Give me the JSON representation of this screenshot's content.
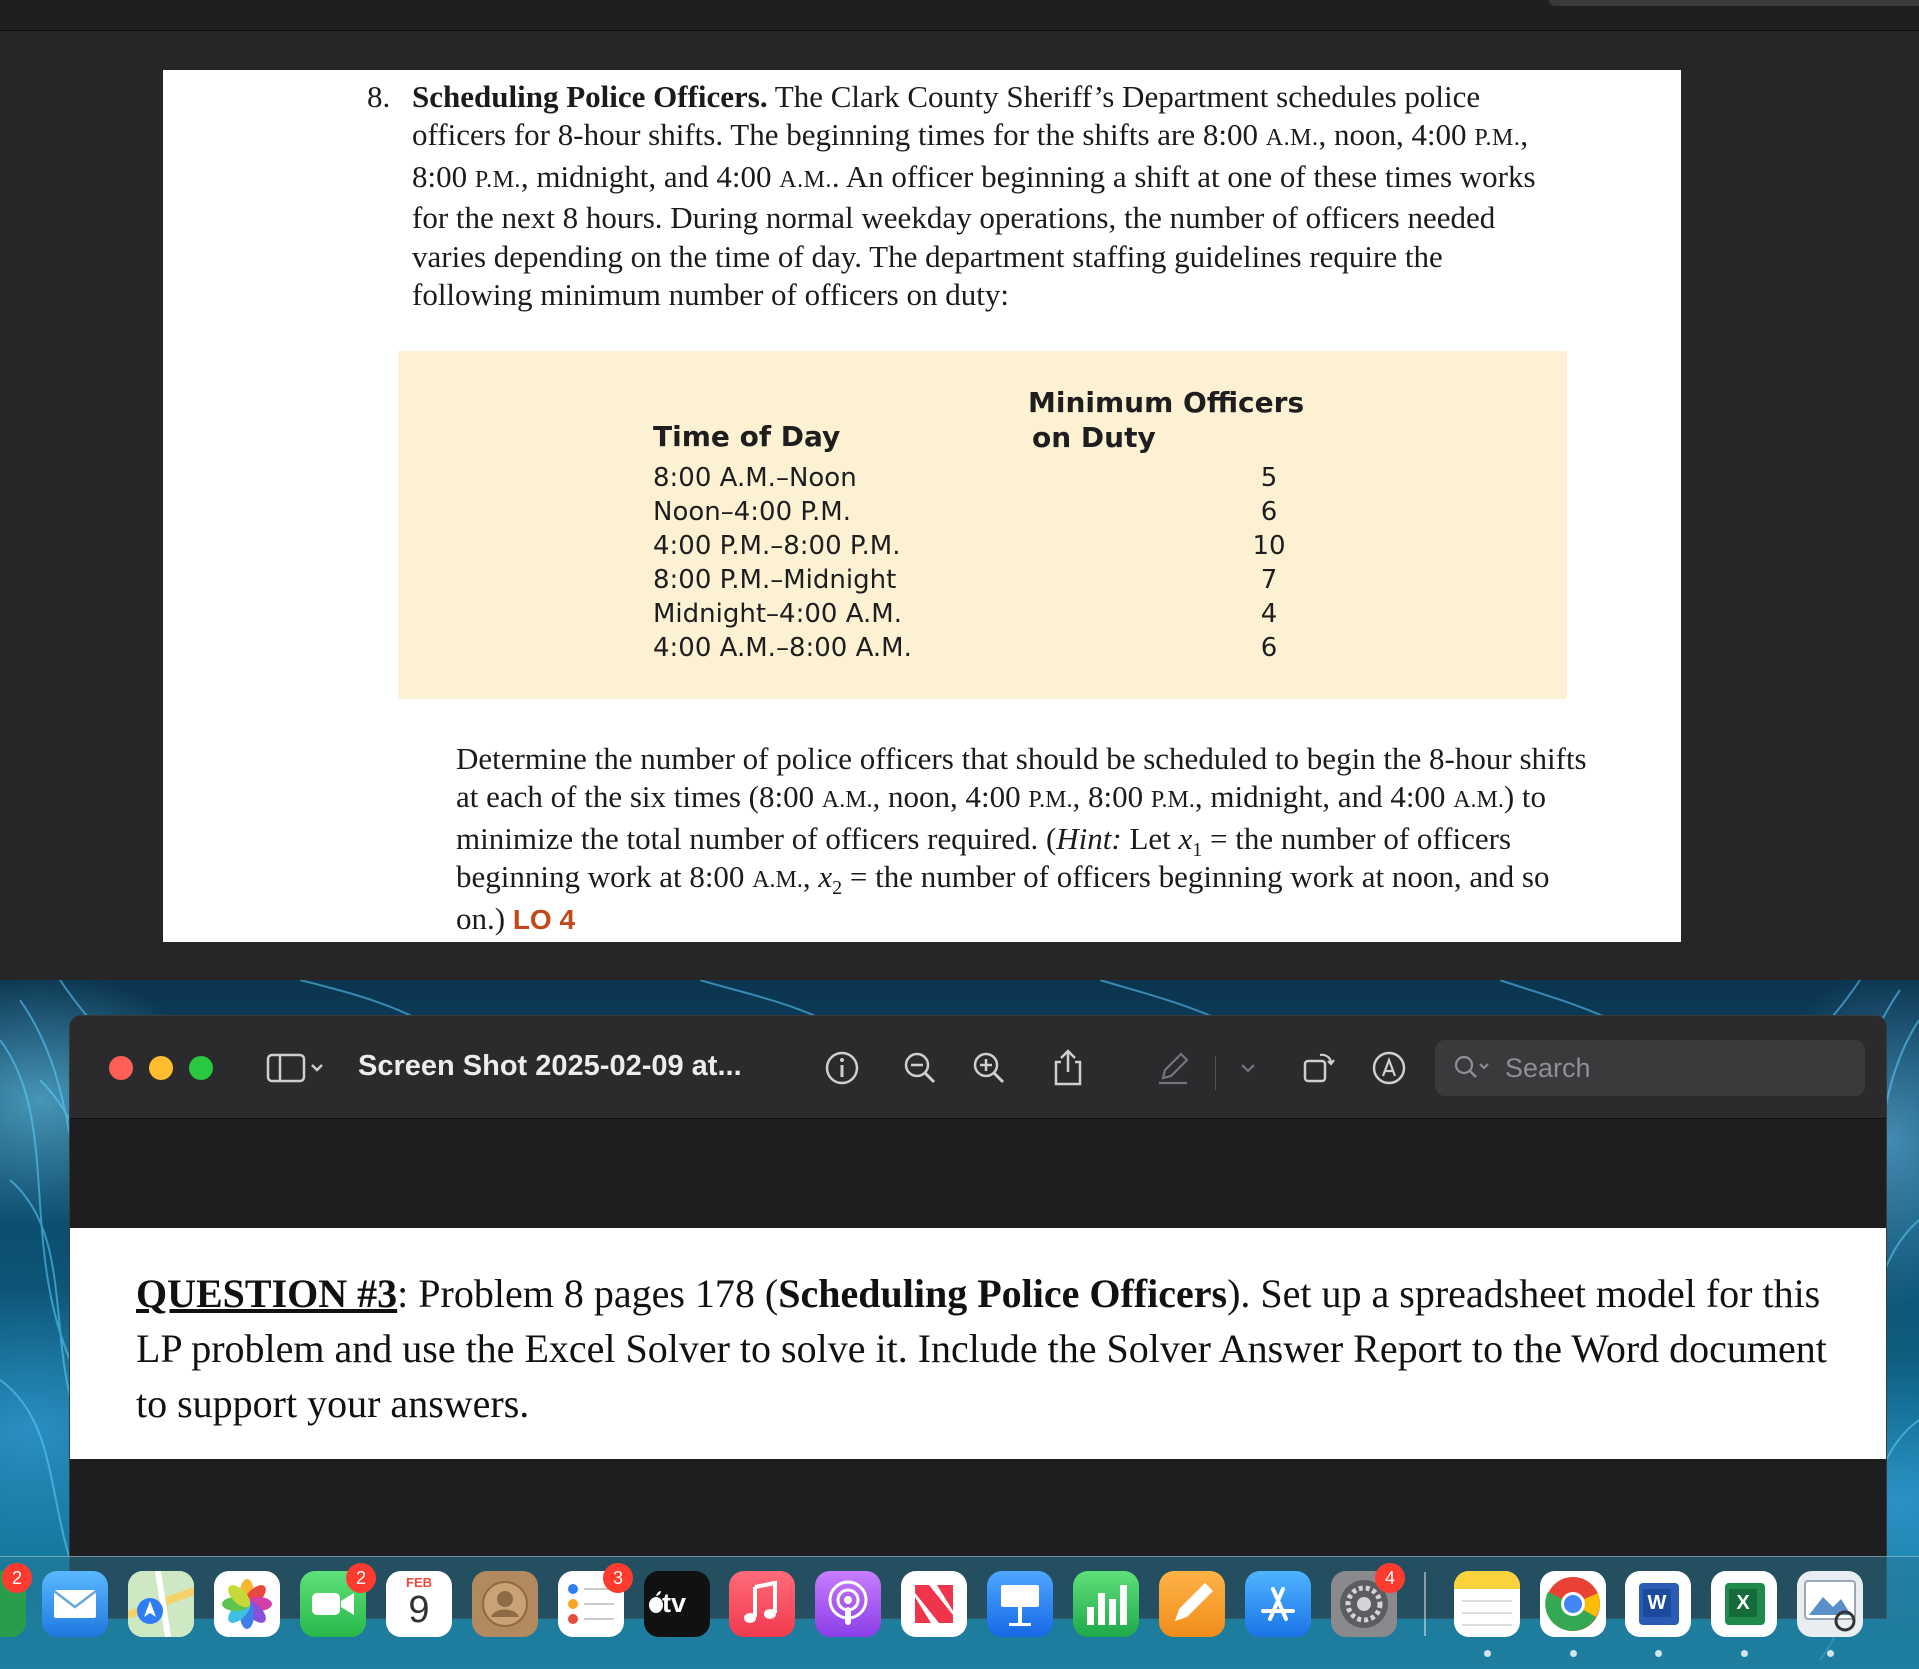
{
  "textbook": {
    "problem_number": "8.",
    "problem_title": "Scheduling Police Officers.",
    "intro_1": " The Clark County Sheriff’s Department schedules police officers for 8-hour shifts. The beginning times for the shifts are 8:00 ",
    "am": "A.M.",
    "pm": "P.M.",
    "intro_2": ", noon, 4:00 ",
    "intro_3": ", 8:00 ",
    "intro_4": ", midnight, and 4:00 ",
    "intro_5": ". An officer beginning a shift at one of these times works for the next 8 hours. During normal weekday operations, the number of officers needed varies depending on the time of day. The department staffing guidelines require the following minimum number of officers on duty:",
    "table_header_time": "Time of Day",
    "table_header_min_1": "Minimum Officers",
    "table_header_min_2": "on Duty",
    "rows": [
      {
        "label": "8:00 A.M.–Noon",
        "value": "5"
      },
      {
        "label": "Noon–4:00 P.M.",
        "value": "6"
      },
      {
        "label": "4:00 P.M.–8:00 P.M.",
        "value": "10"
      },
      {
        "label": "8:00 P.M.–Midnight",
        "value": "7"
      },
      {
        "label": "Midnight–4:00 A.M.",
        "value": "4"
      },
      {
        "label": "4:00 A.M.–8:00 A.M.",
        "value": "6"
      }
    ],
    "det_1": "Determine the number of police officers that should be scheduled to begin the 8-hour shifts at each of the six times (8:00 ",
    "det_2": ", noon, 4:00 ",
    "det_3": ", 8:00 ",
    "det_4": ", midnight, and 4:00 ",
    "det_5": ") to minimize the total number of officers required. (",
    "hint": "Hint:",
    "det_6": " Let ",
    "x1": "x",
    "sub1": "1",
    "det_7": " = the number of officers beginning work at 8:00 ",
    "det_8": ", ",
    "x2": "x",
    "sub2": "2",
    "det_9": " = the number of officers beginning work at noon, and so on.) ",
    "lo": "LO 4"
  },
  "preview_window": {
    "title": "Screen Shot 2025-02-09 at...",
    "search_placeholder": "Search"
  },
  "document": {
    "question_label": "QUESTION #3",
    "text_1": ": Problem 8 pages 178 (",
    "bold_title": "Scheduling Police Officers",
    "text_2": "). Set up a spreadsheet model for this LP problem and use the Excel Solver to solve it. Include the Solver Answer Report to the Word document to support your answers."
  },
  "dock": {
    "badges": {
      "left_app": "2",
      "facetime": "2",
      "reminders": "3",
      "settings": "4"
    },
    "calendar_month": "FEB",
    "calendar_day": "9",
    "tv_label": "tv",
    "word_letter": "W",
    "excel_letter": "X"
  }
}
